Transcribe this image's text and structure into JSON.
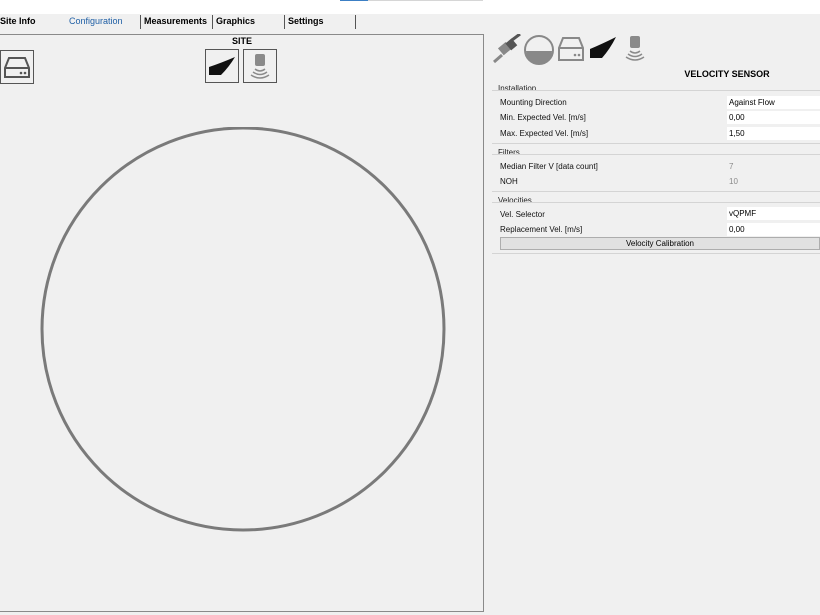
{
  "tabs": [
    {
      "label": "Site Info",
      "active": false
    },
    {
      "label": "Configuration",
      "active": true
    },
    {
      "label": "Measurements",
      "active": false
    },
    {
      "label": "Graphics",
      "active": false
    },
    {
      "label": "Settings",
      "active": false
    }
  ],
  "site": {
    "label": "SITE",
    "icons": [
      "sensor-box-icon",
      "velocity-wedge-icon",
      "ultrasonic-sensor-icon"
    ]
  },
  "right": {
    "toolbar_icons": [
      "connector-icon",
      "pipe-section-icon",
      "sensor-box-icon",
      "velocity-wedge-icon",
      "ultrasonic-sensor-icon"
    ],
    "title": "VELOCITY SENSOR",
    "groups": {
      "installation": {
        "label": "Installation",
        "rows": [
          {
            "label": "Mounting Direction",
            "value": "Against Flow"
          },
          {
            "label": "Min. Expected Vel. [m/s]",
            "value": "0,00"
          },
          {
            "label": "Max. Expected Vel. [m/s]",
            "value": "1,50"
          }
        ]
      },
      "filters": {
        "label": "Filters",
        "rows": [
          {
            "label": "Median Filter V [data count]",
            "value": "7"
          },
          {
            "label": "NOH",
            "value": "10"
          }
        ]
      },
      "velocities": {
        "label": "Velocities",
        "rows": [
          {
            "label": "Vel. Selector",
            "value": "vQPMF"
          },
          {
            "label": "Replacement Vel. [m/s]",
            "value": "0,00"
          }
        ],
        "button": "Velocity Calibration"
      }
    }
  },
  "colors": {
    "accent": "#1f5fa5",
    "background": "#f0f0f0",
    "pipe": "#7a7a7a"
  }
}
